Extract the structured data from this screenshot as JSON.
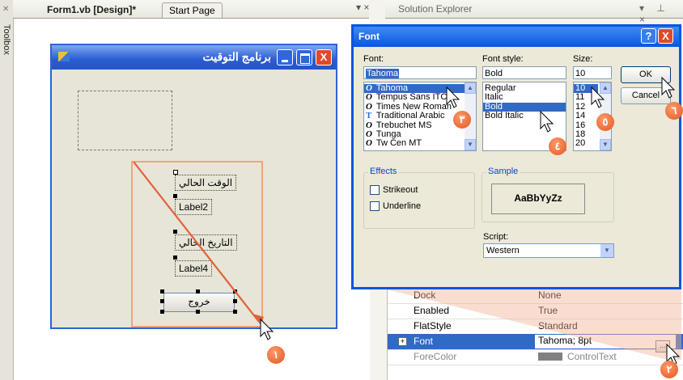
{
  "ide": {
    "toolbox_label": "Toolbox",
    "tabs": [
      {
        "label": "Form1.vb [Design]*"
      },
      {
        "label": "Start Page"
      }
    ],
    "tab_controls": "▾ ×",
    "solution_explorer": {
      "title": "Solution Explorer",
      "controls": "▾ ⊥ ×"
    }
  },
  "form": {
    "title": "برنامج التوقيت",
    "close_glyph": "X",
    "labels": [
      {
        "text": "الوقت الحالي"
      },
      {
        "text": "Label2"
      },
      {
        "text": "التاريخ الحالي"
      },
      {
        "text": "Label4"
      }
    ],
    "exit_button": "خروج"
  },
  "properties": {
    "rows": [
      {
        "name": "Dock",
        "value": "None"
      },
      {
        "name": "Enabled",
        "value": "True"
      },
      {
        "name": "FlatStyle",
        "value": "Standard"
      },
      {
        "name": "Font",
        "value": "Tahoma; 8pt",
        "selected": true
      },
      {
        "name": "ForeColor",
        "value": "ControlText"
      }
    ],
    "expand_glyph": "+",
    "ellipsis": "..."
  },
  "font_dialog": {
    "title": "Font",
    "help_glyph": "?",
    "close_glyph": "X",
    "font_label": "Font:",
    "font_value": "Tahoma",
    "fonts": [
      {
        "name": "Tahoma",
        "icon": "O",
        "selected": true
      },
      {
        "name": "Tempus Sans ITC",
        "icon": "O"
      },
      {
        "name": "Times New Roman",
        "icon": "O"
      },
      {
        "name": "Traditional Arabic",
        "icon": "T"
      },
      {
        "name": "Trebuchet MS",
        "icon": "O"
      },
      {
        "name": "Tunga",
        "icon": "O"
      },
      {
        "name": "Tw Cen MT",
        "icon": "O"
      }
    ],
    "style_label": "Font style:",
    "style_value": "Bold",
    "styles": [
      {
        "name": "Regular"
      },
      {
        "name": "Italic"
      },
      {
        "name": "Bold",
        "selected": true
      },
      {
        "name": "Bold Italic"
      }
    ],
    "size_label": "Size:",
    "size_value": "10",
    "sizes": [
      {
        "name": "10",
        "selected": true
      },
      {
        "name": "11"
      },
      {
        "name": "12"
      },
      {
        "name": "14"
      },
      {
        "name": "16"
      },
      {
        "name": "18"
      },
      {
        "name": "20"
      }
    ],
    "ok_label": "OK",
    "cancel_label": "Cancel",
    "effects_label": "Effects",
    "strikeout_label": "Strikeout",
    "underline_label": "Underline",
    "sample_label": "Sample",
    "sample_text": "AaBbYyZz",
    "script_label": "Script:",
    "script_value": "Western"
  },
  "steps": {
    "one": "١",
    "two": "٢",
    "three": "٣",
    "four": "٤",
    "five": "٥",
    "six": "٦"
  },
  "colors": {
    "accent": "#316ac5",
    "annotation": "#e2561f",
    "titlebar": "#0a55e3"
  }
}
